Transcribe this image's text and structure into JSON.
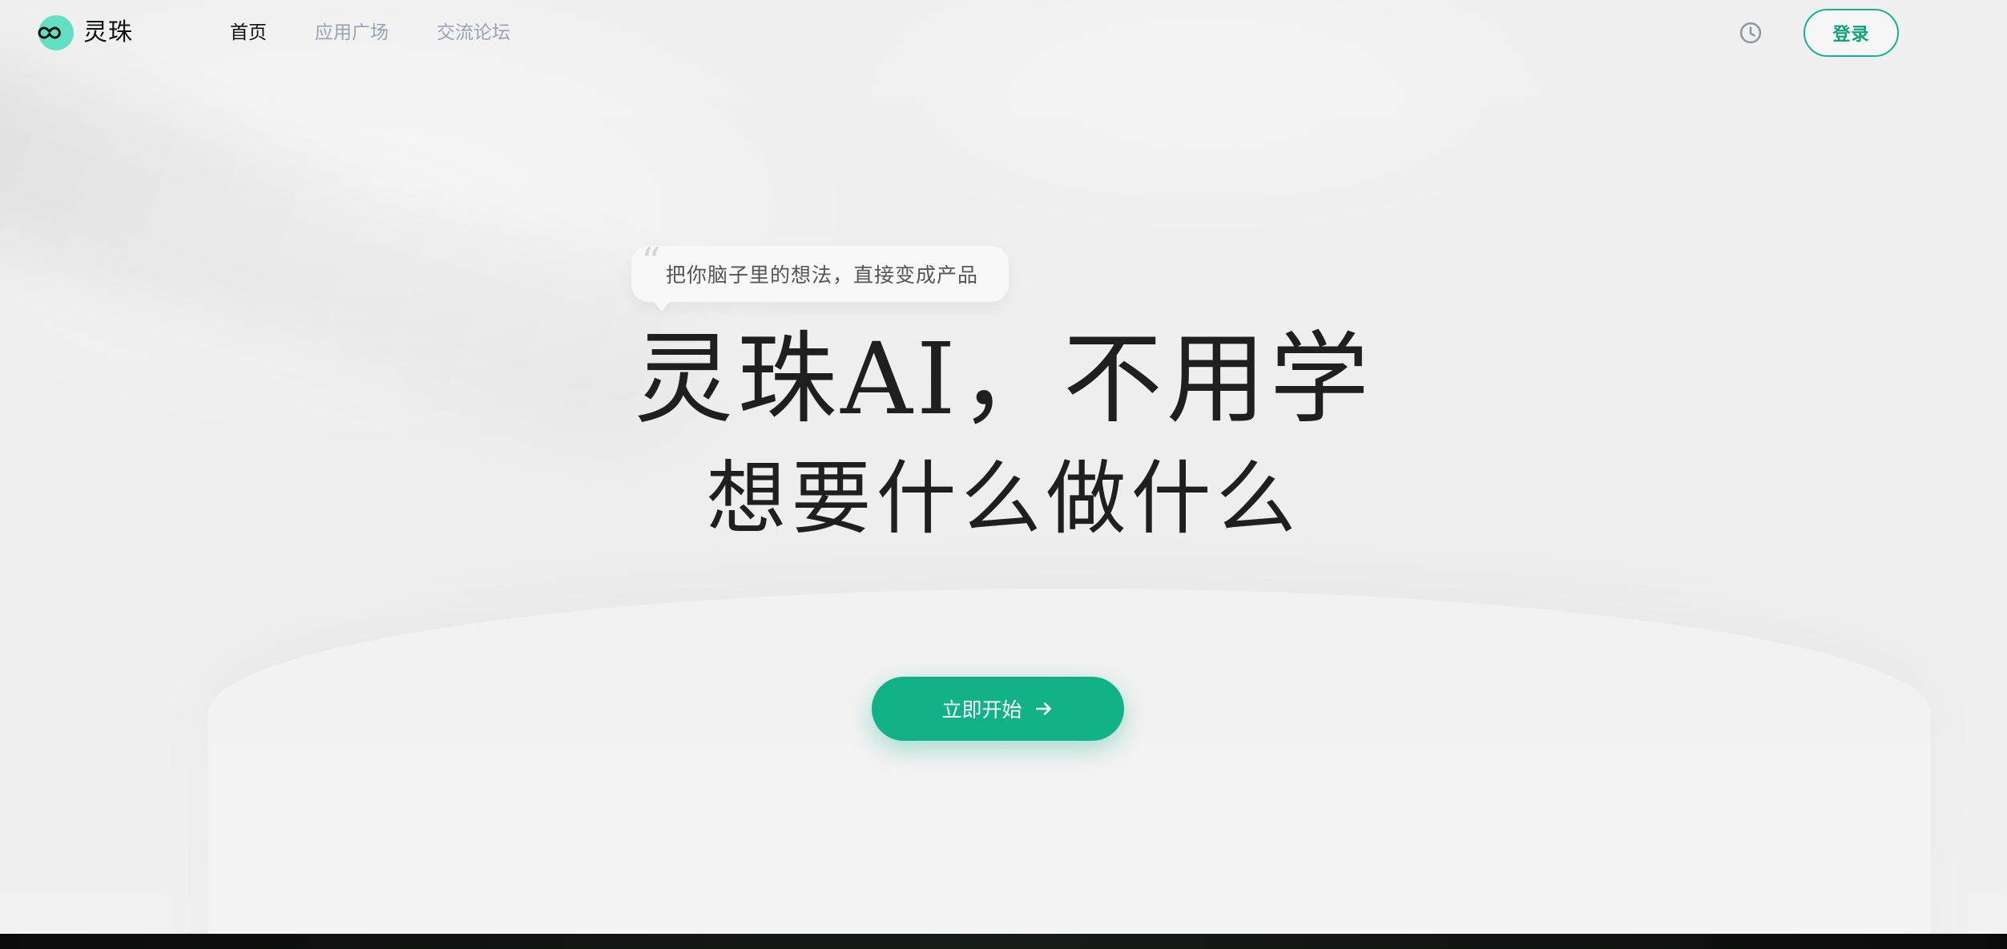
{
  "brand": {
    "name": "灵珠"
  },
  "nav": {
    "items": [
      {
        "label": "首页",
        "active": true
      },
      {
        "label": "应用广场",
        "active": false
      },
      {
        "label": "交流论坛",
        "active": false
      }
    ]
  },
  "header": {
    "history_icon": "clock-icon",
    "login_label": "登录"
  },
  "hero": {
    "bubble_text": "把你脑子里的想法，直接变成产品",
    "headline_line1": "灵珠AI，不用学",
    "headline_line2": "想要什么做什么",
    "cta_label": "立即开始",
    "cta_icon": "arrow-right-icon"
  },
  "colors": {
    "accent": "#11b287",
    "accent_border": "#15b58b",
    "logo_dot": "#63e0c4",
    "nav_muted": "#98a3b3"
  }
}
